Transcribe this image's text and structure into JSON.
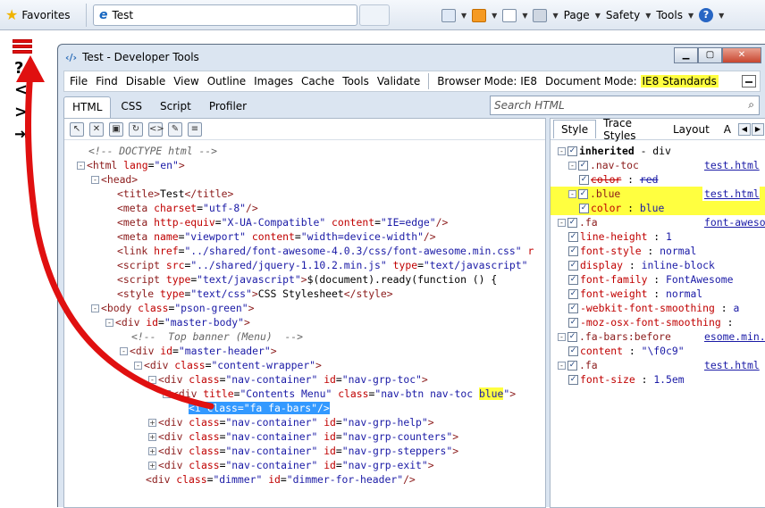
{
  "ie": {
    "favorites_label": "Favorites",
    "tab_title": "Test",
    "page_menu": "Page",
    "safety_menu": "Safety",
    "tools_menu": "Tools",
    "help_glyph": "?"
  },
  "nav_glyphs": {
    "help": "?",
    "back": "<",
    "forward": ">",
    "exit": "⇥"
  },
  "devtools": {
    "title": "Test - Developer Tools",
    "menu": [
      "File",
      "Find",
      "Disable",
      "View",
      "Outline",
      "Images",
      "Cache",
      "Tools",
      "Validate"
    ],
    "browser_mode": "Browser Mode: IE8",
    "document_mode_label": "Document Mode:",
    "document_mode_value": "IE8 Standards",
    "tabs": [
      "HTML",
      "CSS",
      "Script",
      "Profiler"
    ],
    "search_placeholder": "Search HTML",
    "right_tabs": [
      "Style",
      "Trace Styles",
      "Layout",
      "A"
    ]
  },
  "colors": {
    "highlight_yellow": "#ffff40",
    "selection_blue": "#3399ff",
    "arrow_red": "#e01010"
  }
}
